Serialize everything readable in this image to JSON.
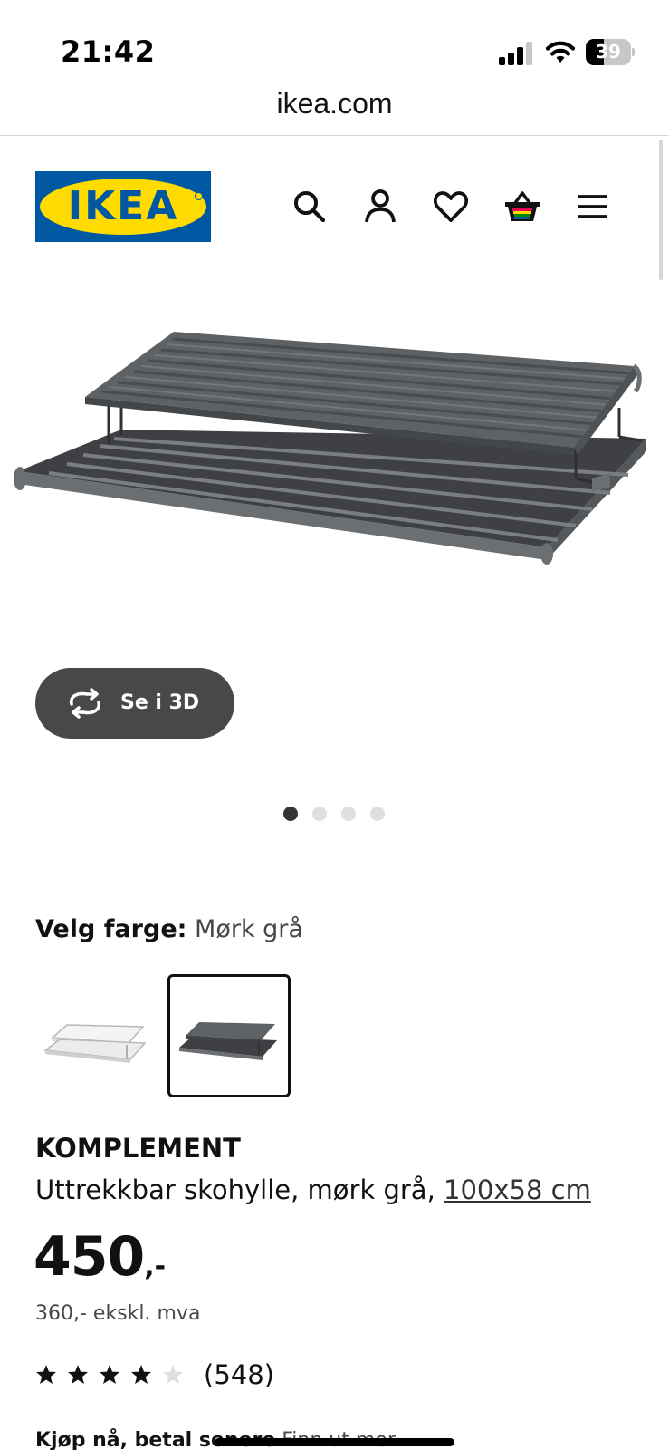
{
  "status_bar": {
    "time": "21:42",
    "battery_level": "39",
    "battery_fraction": 0.39,
    "icons": [
      "cellular-signal-icon",
      "wifi-icon",
      "battery-icon"
    ]
  },
  "browser": {
    "url": "ikea.com"
  },
  "header": {
    "logo_text": "IKEA",
    "icons": [
      "search-icon",
      "account-icon",
      "heart-icon",
      "basket-icon",
      "menu-icon"
    ]
  },
  "gallery": {
    "view_3d_label": "Se i 3D",
    "image_count": 4,
    "active_image": 1
  },
  "color": {
    "label": "Velg farge:",
    "selected": "Mørk grå",
    "swatch_count": 2,
    "selected_swatch": 2
  },
  "product": {
    "name": "KOMPLEMENT",
    "description": "Uttrekkbar skohylle, mørk grå,",
    "size_link": "100x58 cm",
    "price_integer": "450",
    "price_decimal": ",-",
    "price_ex_vat": "360,- ekskl. mva"
  },
  "rating": {
    "stars": 4,
    "max_stars": 5,
    "count": "(548)"
  },
  "financing": {
    "bold_text": "Kjøp nå, betal senere",
    "link_text": "Finn ut mer"
  },
  "colors": {
    "ikea_blue": "#0058a3",
    "ikea_yellow": "#ffdb00",
    "button_gray": "#484848",
    "shelf_gray": "#5f6265",
    "shelf_white": "#f1f1f1"
  }
}
